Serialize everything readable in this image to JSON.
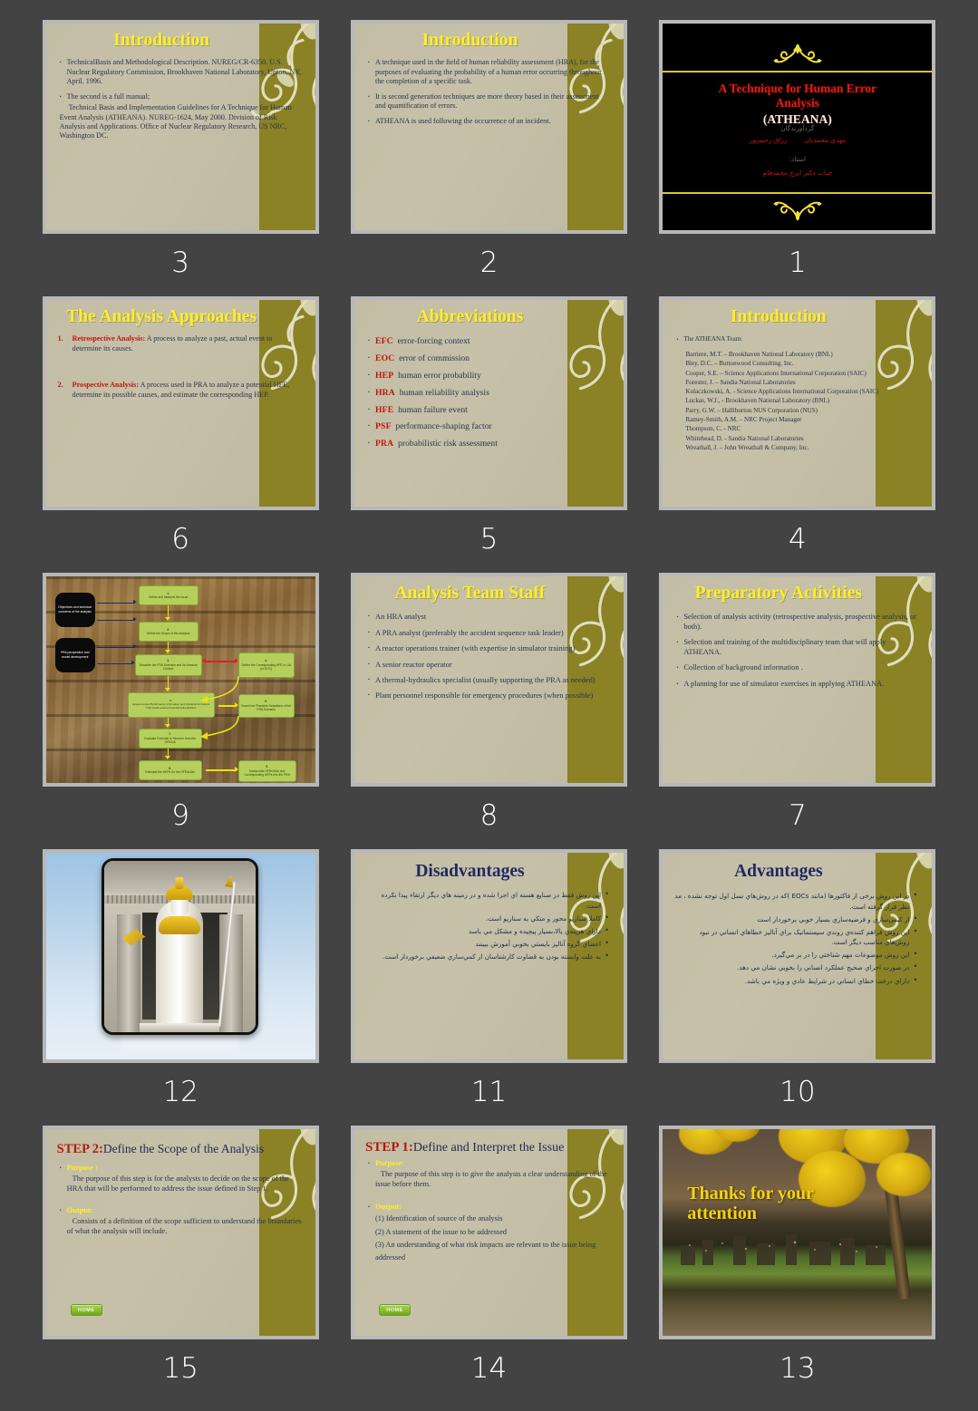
{
  "gallery": {
    "background_color": "#434343",
    "slide_numbers": [
      "3",
      "2",
      "1",
      "6",
      "5",
      "4",
      "9",
      "8",
      "7",
      "12",
      "11",
      "10",
      "15",
      "14",
      "13"
    ]
  },
  "theme": {
    "khaki_bg": "#c2bda4",
    "olive_sidebar": "#8a8224",
    "title_yellow": "#ffef26",
    "title_navy": "#1f2a63",
    "body_text": "#2b3353",
    "accent_red": "#c0150c"
  },
  "slides": {
    "s1": {
      "number": "1",
      "title_line1": "A Technique for Human Error",
      "title_line2": "Analysis",
      "title_line3": "(ATHEANA)",
      "fa_label_authors": "گردآورندگان",
      "fa_author1": "مهدی محمدیان",
      "fa_author2": "رزاق رحیم‌پور",
      "fa_label_advisor": "استاد:",
      "fa_advisor": "جناب دکتر ایرج محمدفام"
    },
    "s2": {
      "number": "2",
      "title": "Introduction",
      "bullets": [
        "A technique used in the field of human reliability assessment (HRA), for the purposes of evaluating the probability of a human error occurring throughout the completion of a specific task.",
        "It is second generation techniques are more theory based in their assessment and quantification of errors.",
        "ATHEANA is used following the occurrence of an incident."
      ]
    },
    "s3": {
      "number": "3",
      "title": "Introduction",
      "bullet1": "TechnicalBasis and Methodological Description. NUREG/CR-6350. U.S. Nuclear Regulatory Commission, Brookhaven National Laboratory, Upton, NY, April. 1996.",
      "bullet2": "The second is a full manual;",
      "paragraph": "Technical Basis and Implementation Guidelines for A Technique for Human Event Analysis (ATHEANA). NUREG-1624, May 2000. Division of Risk Analysis and Applications. Office of Nuclear Regulatory Research, US NRC, Washington DC."
    },
    "s4": {
      "number": "4",
      "title": "Introduction",
      "lead": "The ATHEANA Team:",
      "members": [
        "Barriere, M.T. – Brookhaven National Laboratory (BNL)",
        "Bley, D.C. – Buttonwood Consulting, Inc.",
        "Cooper, S.E. – Science Applications International Corporation (SAIC)",
        "Forester, J. – Sandia National Laboratories",
        "Kolaczkowski, A. - Science Applications International Corporation (SAIC)",
        "Luckas, W.J., - Brookhaven National Laboratory (BNL)",
        "Parry, G.W. – Halliburton NUS Corporation (NUS)",
        "Ramey-Smith, A.M. – NRC Project Manager",
        "Thompson, C. - NRC",
        "Whitehead, D. - Sandia National Laboratories",
        "Wreathall, J. – John Wreathall & Company, Inc."
      ]
    },
    "s5": {
      "number": "5",
      "title": "Abbreviations",
      "items": [
        {
          "key": "EFC",
          "meaning": "error-forcing context"
        },
        {
          "key": "EOC",
          "meaning": "error of commission"
        },
        {
          "key": "HEP",
          "meaning": "human error probability"
        },
        {
          "key": "HRA",
          "meaning": "human reliability analysis"
        },
        {
          "key": "HFE",
          "meaning": "human failure event"
        },
        {
          "key": "PSF",
          "meaning": "performance-shaping factor"
        },
        {
          "key": "PRA",
          "meaning": "probabilistic risk assessment"
        }
      ]
    },
    "s6": {
      "number": "6",
      "title": "The Analysis Approaches",
      "item1_num": "1.",
      "item1_label": "Retrospective Analysis:",
      "item1_text": " A process to analyze a past, actual event to determine its causes.",
      "item2_num": "2.",
      "item2_label": "Prospective Analysis:",
      "item2_text": " A process used in PRA to analyze a potential HFE, determine its possible causes, and estimate the corresponding HEP."
    },
    "s7": {
      "number": "7",
      "title": "Preparatory Activities",
      "bullets": [
        "Selection of analysis activity (retrospective analysis, prospective analysis, or both).",
        "Selection and training of the multidisciplinary team that will apply ATHEANA.",
        "Collection of background information .",
        "A planning for use of simulator exercises in applying ATHEANA."
      ]
    },
    "s8": {
      "number": "8",
      "title": "Analysis Team Staff",
      "bullets": [
        "An HRA analyst",
        "A PRA analyst (preferably the accident sequence task leader)",
        "A reactor operations trainer (with expertise in simulator training)",
        "A senior reactor operator",
        "A thermal-hydraulics specialist (usually supporting the PRA as needed)",
        "Plant personnel responsible for emergency procedures (when possible)"
      ]
    },
    "s9": {
      "number": "9",
      "flowchart": {
        "inputs": [
          "Objectives and technical concerns of the analysis",
          "PRA perspective and model development"
        ],
        "steps": [
          {
            "n": "1.",
            "text": "Define and Interpret the Issue"
          },
          {
            "n": "2.",
            "text": "Define the Scope of the Analysis"
          },
          {
            "n": "3.",
            "text": "Describe the PRA Scenario and its Nominal Context"
          },
          {
            "n": "4.",
            "text": "Define the Corresponding HFE or UA (or EOC)"
          },
          {
            "n": "5.",
            "text": "Assess Human Performance Information and Characterize Factors That Could Lead to Potential Vulnerabilities"
          },
          {
            "n": "6.",
            "text": "Search for Plausible Deviations of the PRA Scenario"
          },
          {
            "n": "7.",
            "text": "Evaluate Potential to Recover from the HFE/UA"
          },
          {
            "n": "8.",
            "text": "Estimate the HEPs for the HFEs/UAs"
          },
          {
            "n": "9.",
            "text": "Incorporate HFEs/UAs and Corresponding HEPs into the PRA"
          }
        ]
      }
    },
    "s10": {
      "number": "10",
      "title": "Advantages",
      "bullets": [
        "در این روش برخی از فاکتورها (مانند EOCs )که در روش‌هاي نسل اول توجه نشده ، مد نظر قرار گرفته است.",
        "از کیفی‌سازي و فرضیه‌سازي بسیار خوبي برخوردار است",
        "این روش فراهم کننده‌ي روندي سیستماتیک براي آنالیز خطاهاي انساني در نبود روش‌هاي مناسب دیگر است.",
        "این روش موضوعات مهم شناختي را در بر مي‌گیرد.",
        "در صورت اجراي صحیح عملکرد انساني را بخوبي نشان مي دهد.",
        "داراي درخت خطاي انساني در شرایط عادي و ویژه مي باشد."
      ]
    },
    "s11": {
      "number": "11",
      "title": "Disadvantages",
      "bullets": [
        "این روش فقط در صنایع هسته اي اجرا شده و در زمینه هاي دیگر ارتقاء پیدا نکرده است.",
        "کاملا سناریو محور و متکي به سناریو است.",
        "داراي هزینه‌ي بالا،بسیار پیچیده و مشکل مي باسد",
        "اعضاي گروه آنالیز بایستي بخوبي آموزش ببینند",
        "به علت وابسته بودن به قضاوت کارشناسان از کمي‌سازي ضعیفي برخوردار است."
      ]
    },
    "s12": {
      "number": "12",
      "image_alt": "Pallas Athena statue"
    },
    "s13": {
      "number": "13",
      "text_line1": "Thanks for your",
      "text_line2": "attention"
    },
    "s14": {
      "number": "14",
      "step_label": "STEP 1:",
      "step_title": "Define and Interpret the Issue",
      "purpose_label": "Purpose:",
      "purpose_text": "The purpose of this step is to give the analysts a clear understanding of the issue before them.",
      "output_label": "Output:",
      "outputs": [
        "(1) Identification of source of the analysis",
        "(2) A statement of the issue to be addressed",
        "(3) An understanding of what risk impacts are relevant to the  issue being   addressed"
      ],
      "home_button": "HOME"
    },
    "s15": {
      "number": "15",
      "step_label": "STEP 2:",
      "step_title": "Define the Scope of the Analysis",
      "purpose_label": "Purpose :",
      "purpose_text": "The purpose of this step is for the analysts to decide on the scope of the HRA that will be performed to address the issue defined in Step 1.",
      "output_label": "Output:",
      "output_text": "Consists of a definition of the scope sufficient to understand the boundaries of what the analysis will include.",
      "home_button": "HOME"
    }
  }
}
